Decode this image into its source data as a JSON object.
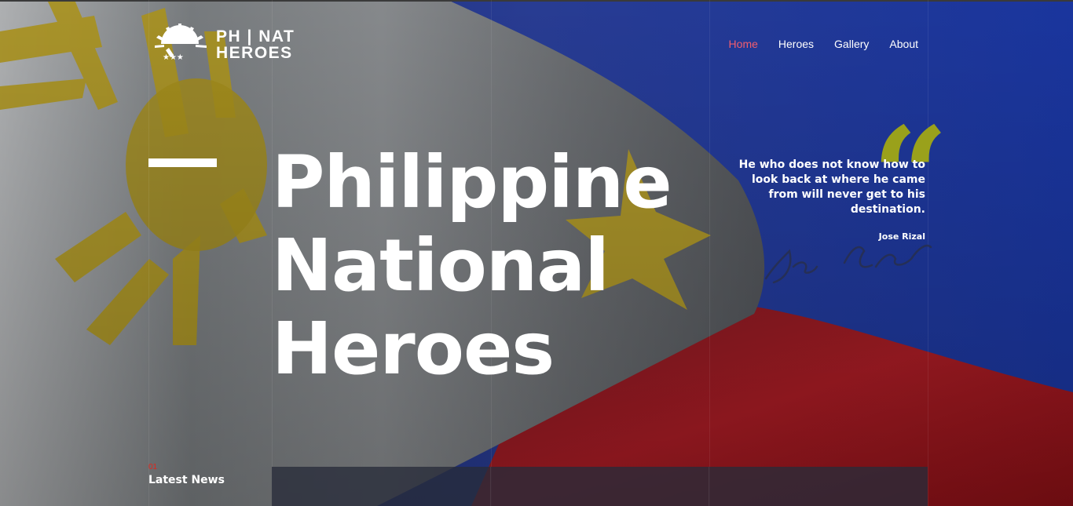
{
  "header": {
    "logo": {
      "line1": "PH | NAT",
      "line2": "HEROES"
    },
    "nav": [
      {
        "label": "Home",
        "active": true
      },
      {
        "label": "Heroes",
        "active": false
      },
      {
        "label": "Gallery",
        "active": false
      },
      {
        "label": "About",
        "active": false
      }
    ]
  },
  "hero": {
    "title_lines": [
      "Philippine",
      "National",
      "Heroes"
    ],
    "quote": "He who does not know how to look back at where he came from will never get to his destination.",
    "author": "Jose Rizal",
    "quote_mark": "“"
  },
  "news": {
    "number": "01",
    "title": "Latest News"
  },
  "colors": {
    "accent": "#f25d6e",
    "quote_mark": "#9aa11b",
    "news_number": "#e2261c"
  }
}
